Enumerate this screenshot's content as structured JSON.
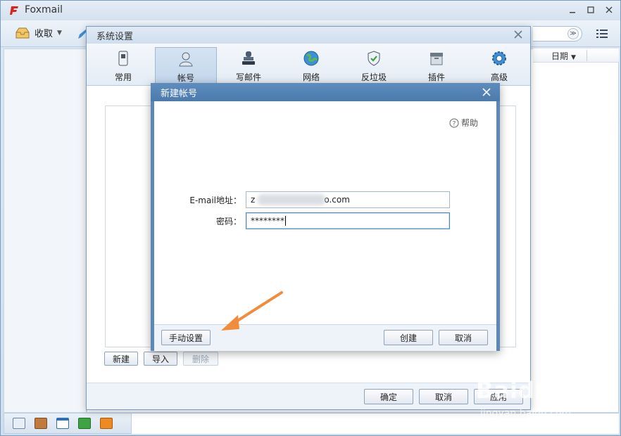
{
  "app": {
    "title": "Foxmail",
    "toolbar": {
      "receive_label": "收取"
    },
    "list_header": {
      "date_label": "日期"
    }
  },
  "settings_dialog": {
    "title": "系统设置",
    "tabs": [
      {
        "label": "常用",
        "icon": "phone-icon"
      },
      {
        "label": "帐号",
        "icon": "user-icon",
        "active": true
      },
      {
        "label": "写邮件",
        "icon": "stamp-icon"
      },
      {
        "label": "网络",
        "icon": "globe-icon"
      },
      {
        "label": "反垃圾",
        "icon": "shield-icon"
      },
      {
        "label": "插件",
        "icon": "box-icon"
      },
      {
        "label": "高级",
        "icon": "gear-icon"
      }
    ],
    "account_buttons": {
      "new": "新建",
      "import": "导入",
      "delete": "删除"
    },
    "footer": {
      "ok": "确定",
      "cancel": "取消",
      "apply": "应用"
    }
  },
  "new_account_dialog": {
    "title": "新建帐号",
    "help": "帮助",
    "email_label": "E-mail地址：",
    "email_prefix": "z",
    "email_suffix": "o.com",
    "password_label": "密码：",
    "password_value": "********",
    "manual_setup": "手动设置",
    "create": "创建",
    "cancel": "取消"
  },
  "watermark": {
    "main": "Baidu 经验",
    "sub": "jingyan.baidu.com"
  },
  "colors": {
    "accent": "#5b88b8",
    "arrow": "#f08c3a"
  }
}
